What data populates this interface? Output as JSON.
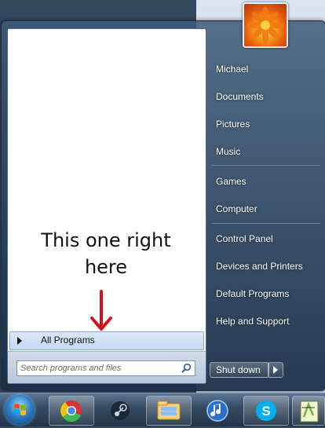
{
  "annotation": {
    "line1": "This one right",
    "line2": "here"
  },
  "all_programs": {
    "label": "All Programs"
  },
  "search": {
    "placeholder": "Search programs and files"
  },
  "right_pane": {
    "items": [
      {
        "label": "Michael"
      },
      {
        "label": "Documents"
      },
      {
        "label": "Pictures"
      },
      {
        "label": "Music"
      },
      {
        "label": "Games"
      },
      {
        "label": "Computer"
      },
      {
        "label": "Control Panel"
      },
      {
        "label": "Devices and Printers"
      },
      {
        "label": "Default Programs"
      },
      {
        "label": "Help and Support"
      }
    ]
  },
  "shutdown": {
    "label": "Shut down"
  },
  "taskbar": {
    "buttons": [
      "chrome-icon",
      "steam-icon",
      "windows-explorer-icon",
      "itunes-icon",
      "skype-icon",
      "notepad-plus-plus-icon"
    ]
  },
  "colors": {
    "annotation_arrow": "#d0121e",
    "accent": "#89a9d4"
  }
}
